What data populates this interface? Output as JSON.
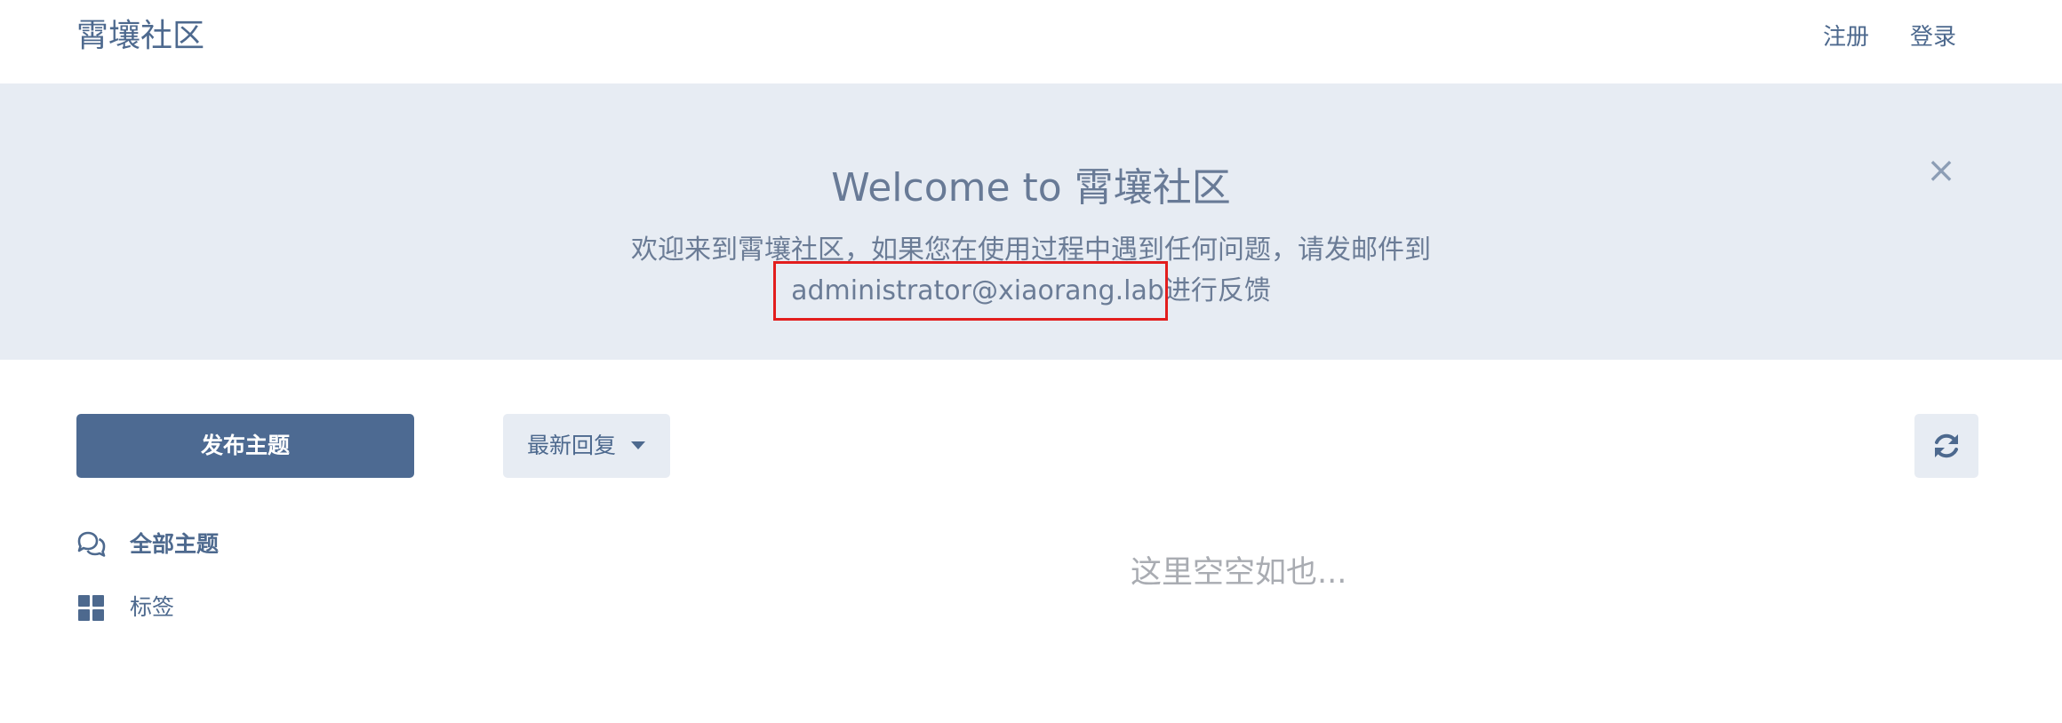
{
  "header": {
    "brand": "霄壤社区",
    "register": "注册",
    "login": "登录"
  },
  "hero": {
    "title": "Welcome to 霄壤社区",
    "text_line1": "欢迎来到霄壤社区，如果您在使用过程中遇到任何问题，请发邮件到",
    "email": "administrator@xiaorang.lab",
    "text_after_email": "进行反馈",
    "close_icon": "×"
  },
  "toolbar": {
    "publish_label": "发布主题",
    "sort_label": "最新回复",
    "refresh_icon": "refresh-icon"
  },
  "sidebar": {
    "items": [
      {
        "label": "全部主题",
        "icon": "chat-bubbles-icon",
        "active": true
      },
      {
        "label": "标签",
        "icon": "tags-grid-icon",
        "active": false
      }
    ]
  },
  "main": {
    "empty_text": "这里空空如也..."
  },
  "colors": {
    "primary": "#4d6a92",
    "hero_bg": "#e7ecf3",
    "highlight": "#e21d1d",
    "muted_text": "#a9acb2"
  }
}
